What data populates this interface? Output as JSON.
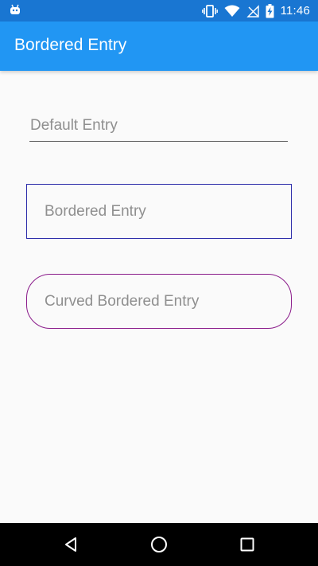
{
  "status_bar": {
    "time": "11:46",
    "icons": [
      "android-debug-icon",
      "vibrate-icon",
      "wifi-icon",
      "no-sim-icon",
      "battery-charging-icon"
    ]
  },
  "app_bar": {
    "title": "Bordered Entry"
  },
  "entries": {
    "default_placeholder": "Default Entry",
    "bordered_placeholder": "Bordered Entry",
    "curved_placeholder": "Curved Bordered Entry"
  },
  "colors": {
    "app_bar": "#2196f3",
    "status_bar": "#1976d2",
    "bordered_border": "#2a2aa8",
    "curved_border": "#8a1b8a"
  },
  "nav_bar": {
    "icons": [
      "back-icon",
      "home-icon",
      "recents-icon"
    ]
  }
}
